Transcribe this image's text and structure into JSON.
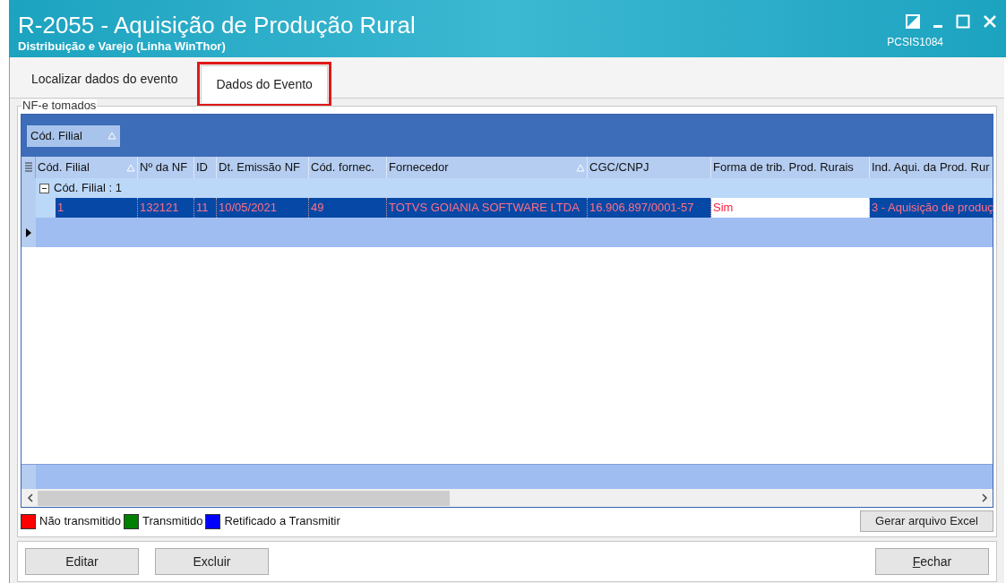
{
  "window": {
    "title": "R-2055 - Aquisição de Produção Rural",
    "subtitle": "Distribuição e Varejo (Linha WinThor)",
    "code": "PCSIS1084"
  },
  "tabs": [
    {
      "label": "Localizar dados do evento",
      "selected": false,
      "highlighted": false
    },
    {
      "label": "Dados do Evento",
      "selected": true,
      "highlighted": true
    }
  ],
  "group_box": {
    "title": "NF-e tomados"
  },
  "grid": {
    "group_by": {
      "label": "Cód. Filial",
      "sorted": true
    },
    "columns": [
      {
        "label": "Cód. Filial",
        "sorted": true
      },
      {
        "label": "Nº da NF",
        "sorted": false
      },
      {
        "label": "ID",
        "sorted": false
      },
      {
        "label": "Dt. Emissão NF",
        "sorted": false
      },
      {
        "label": "Cód. fornec.",
        "sorted": false
      },
      {
        "label": "Fornecedor",
        "sorted": true
      },
      {
        "label": "CGC/CNPJ",
        "sorted": false
      },
      {
        "label": "Forma de trib. Prod. Rurais",
        "sorted": false
      },
      {
        "label": "Ind. Aqui. da Prod. Rur"
      }
    ],
    "group_row": {
      "label": "Cód. Filial : 1",
      "expanded": true
    },
    "rows": [
      {
        "selected": true,
        "cells": [
          {
            "text": "1",
            "focused": false
          },
          {
            "text": "132121",
            "focused": false
          },
          {
            "text": "11",
            "focused": false
          },
          {
            "text": "10/05/2021",
            "focused": false
          },
          {
            "text": "49",
            "focused": false
          },
          {
            "text": "TOTVS GOIANIA SOFTWARE LTDA",
            "focused": false
          },
          {
            "text": "16.906.897/0001-57",
            "focused": false
          },
          {
            "text": "Sim",
            "focused": true
          },
          {
            "text": "3 - Aquisição de produç",
            "focused": false
          }
        ]
      }
    ]
  },
  "legend": [
    {
      "label": "Não transmitido",
      "color": "#ff0000"
    },
    {
      "label": "Transmitido",
      "color": "#008000"
    },
    {
      "label": "Retificado a Transmitir",
      "color": "#0000ff"
    }
  ],
  "excel_button": "Gerar arquivo Excel",
  "buttons": [
    {
      "label": "Editar",
      "accel": false
    },
    {
      "label": "Excluir",
      "accel": false
    },
    {
      "label": "Fechar",
      "accel": true
    }
  ]
}
